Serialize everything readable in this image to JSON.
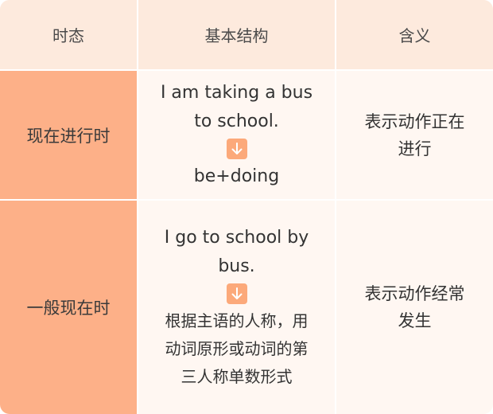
{
  "header": {
    "tense": "时态",
    "structure": "基本结构",
    "meaning": "含义"
  },
  "rows": [
    {
      "tense": "现在进行时",
      "example_line1": "I am taking a bus",
      "example_line2": "to school.",
      "structure_line1": "be+doing",
      "meaning_line1": "表示动作正在",
      "meaning_line2": "进行"
    },
    {
      "tense": "一般现在时",
      "example_line1": "I go to school by",
      "example_line2": "bus.",
      "structure_line1": "根据主语的人称，用",
      "structure_line2": "动词原形或动词的第",
      "structure_line3": "三人称单数形式",
      "meaning_line1": "表示动作经常",
      "meaning_line2": "发生"
    }
  ],
  "icons": {
    "arrow": "arrow-down-icon"
  },
  "colors": {
    "header_bg": "#fdeadd",
    "tense_column_bg": "#fdb088",
    "body_bg": "#fff7f2",
    "arrow_bg": "#fca97a"
  }
}
